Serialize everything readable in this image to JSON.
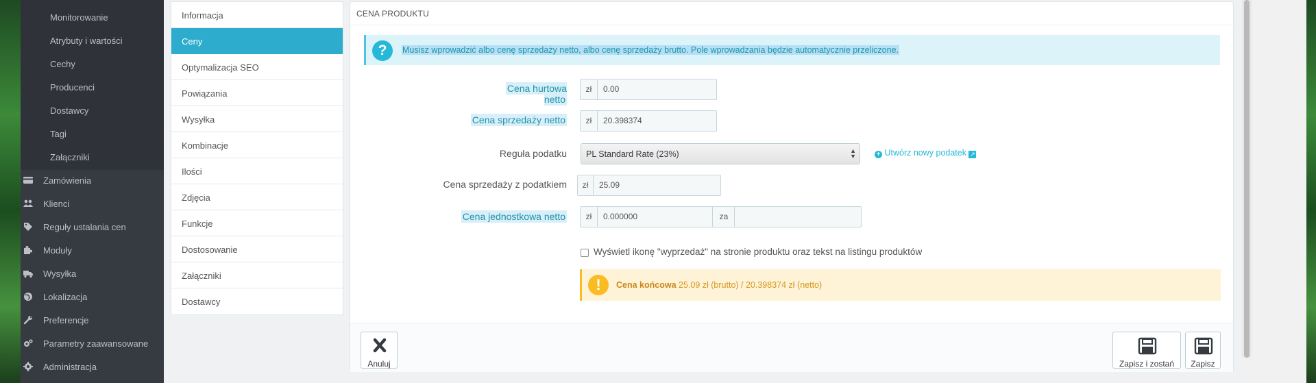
{
  "sidebar": {
    "submenu": [
      "Monitorowanie",
      "Atrybuty i wartości",
      "Cechy",
      "Producenci",
      "Dostawcy",
      "Tagi",
      "Załączniki"
    ],
    "menu": [
      {
        "label": "Zamówienia",
        "icon": "credit-card-icon"
      },
      {
        "label": "Klienci",
        "icon": "users-icon"
      },
      {
        "label": "Reguły ustalania cen",
        "icon": "tags-icon"
      },
      {
        "label": "Moduły",
        "icon": "puzzle-icon"
      },
      {
        "label": "Wysyłka",
        "icon": "truck-icon"
      },
      {
        "label": "Lokalizacja",
        "icon": "globe-icon"
      },
      {
        "label": "Preferencje",
        "icon": "wrench-icon"
      },
      {
        "label": "Parametry zaawansowane",
        "icon": "cogs-icon"
      },
      {
        "label": "Administracja",
        "icon": "gear-icon"
      }
    ]
  },
  "tabs": [
    "Informacja",
    "Ceny",
    "Optymalizacja SEO",
    "Powiązania",
    "Wysyłka",
    "Kombinacje",
    "Ilości",
    "Zdjęcia",
    "Funkcje",
    "Dostosowanie",
    "Załączniki",
    "Dostawcy"
  ],
  "active_tab": "Ceny",
  "panel": {
    "title": "CENA PRODUKTU",
    "info": "Musisz wprowadzić albo cenę sprzedaży netto, albo cenę sprzedaży brutto. Pole wprowadzania będzie automatycznie przeliczone.",
    "fields": {
      "wholesale": {
        "label": "Cena hurtowa netto",
        "currency": "zł",
        "value": "0.00"
      },
      "net": {
        "label": "Cena sprzedaży netto",
        "currency": "zł",
        "value": "20.398374"
      },
      "tax_rule": {
        "label": "Reguła podatku",
        "value": "PL Standard Rate (23%)",
        "link": "Utwórz nowy podatek"
      },
      "gross": {
        "label": "Cena sprzedaży z podatkiem",
        "currency": "zł",
        "value": "25.09"
      },
      "unit": {
        "label": "Cena jednostkowa netto",
        "currency": "zł",
        "value": "0.000000",
        "per": "za",
        "unit_value": ""
      }
    },
    "on_sale_label": "Wyświetl ikonę \"wyprzedaż\" na stronie produktu oraz tekst na listingu produktów",
    "on_sale_checked": false,
    "final_price": {
      "label": "Cena końcowa",
      "text": "25.09 zł (brutto) / 20.398374 zł (netto)"
    },
    "buttons": {
      "cancel": "Anuluj",
      "save_stay": "Zapisz i zostań",
      "save": "Zapisz"
    }
  },
  "colors": {
    "sidebar": "#363a41",
    "accent": "#2eacce",
    "info_bg": "#dcf4f9",
    "warning_bg": "#fff3d7"
  }
}
